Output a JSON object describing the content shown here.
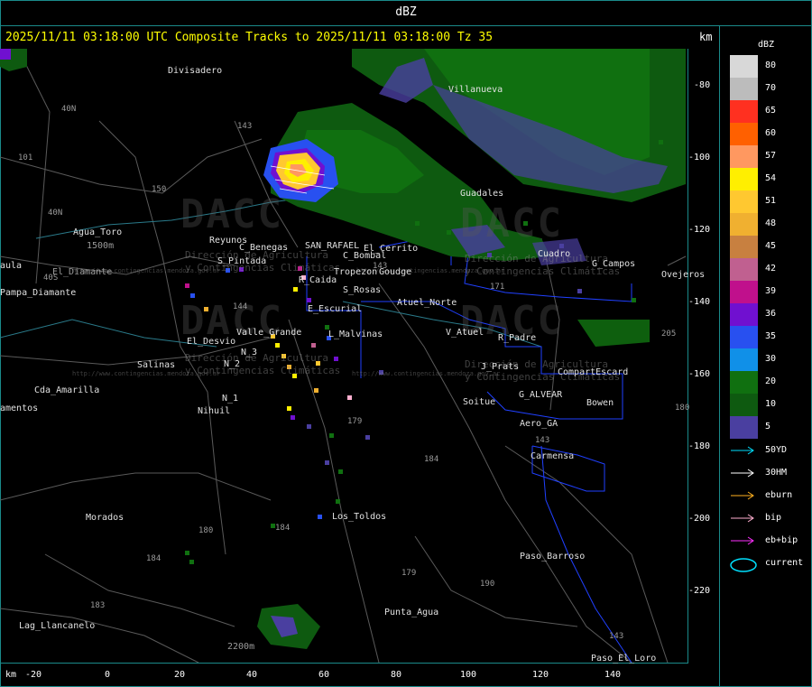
{
  "window": {
    "title": "dBZ"
  },
  "header": {
    "subtitle": "2025/11/11 03:18:00 UTC Composite Tracks to 2025/11/11 03:18:00 Tz 35",
    "km_label": "km"
  },
  "legend": {
    "title": "dBZ",
    "levels": [
      {
        "label": "80",
        "color": "#d8d8d8"
      },
      {
        "label": "70",
        "color": "#bcbcbc"
      },
      {
        "label": "65",
        "color": "#ff3020"
      },
      {
        "label": "60",
        "color": "#ff6000"
      },
      {
        "label": "57",
        "color": "#ff9860"
      },
      {
        "label": "54",
        "color": "#ffef00"
      },
      {
        "label": "51",
        "color": "#ffc830"
      },
      {
        "label": "48",
        "color": "#f0b030"
      },
      {
        "label": "45",
        "color": "#c88040"
      },
      {
        "label": "42",
        "color": "#c06090"
      },
      {
        "label": "39",
        "color": "#c0108c"
      },
      {
        "label": "36",
        "color": "#7010d0"
      },
      {
        "label": "35",
        "color": "#2850f0"
      },
      {
        "label": "30",
        "color": "#1090e8"
      },
      {
        "label": "20",
        "color": "#107010"
      },
      {
        "label": "10",
        "color": "#0e5a10"
      },
      {
        "label": "5",
        "color": "#4a3fa0"
      }
    ]
  },
  "tracks": [
    {
      "label": "50YD",
      "color": "#00e0ff"
    },
    {
      "label": "30HM",
      "color": "#ffffff"
    },
    {
      "label": "eburn",
      "color": "#ffb020"
    },
    {
      "label": "bip",
      "color": "#ffb0d0"
    },
    {
      "label": "eb+bip",
      "color": "#ff30ff"
    },
    {
      "label": "current",
      "color": "#00e0ff"
    }
  ],
  "axes": {
    "x_unit": "km",
    "x_ticks": [
      "-20",
      "0",
      "20",
      "40",
      "60",
      "80",
      "100",
      "120",
      "140"
    ],
    "y_ticks": [
      "-80",
      "-100",
      "-120",
      "-140",
      "-160",
      "-180",
      "-200",
      "-220"
    ]
  },
  "places": [
    {
      "name": "Divisadero"
    },
    {
      "name": "Villanueva"
    },
    {
      "name": "Agua_Toro"
    },
    {
      "name": "1500m"
    },
    {
      "name": "aula"
    },
    {
      "name": "El_Diamante"
    },
    {
      "name": "Reyunos"
    },
    {
      "name": "S_Pintada"
    },
    {
      "name": "Pampa_Diamante"
    },
    {
      "name": "C_Benegas"
    },
    {
      "name": "SAN_RAFAEL"
    },
    {
      "name": "El_Cerrito"
    },
    {
      "name": "C_Bombal"
    },
    {
      "name": "Tropezon"
    },
    {
      "name": "Goudge"
    },
    {
      "name": "R_Caida"
    },
    {
      "name": "S_Rosas"
    },
    {
      "name": "Atuel_Norte"
    },
    {
      "name": "E_Escurial"
    },
    {
      "name": "Valle_Grande"
    },
    {
      "name": "El_Desvio"
    },
    {
      "name": "L_Malvinas"
    },
    {
      "name": "V_Atuel"
    },
    {
      "name": "R_Padre"
    },
    {
      "name": "Salinas"
    },
    {
      "name": "N_2"
    },
    {
      "name": "N_3"
    },
    {
      "name": "Cda_Amarilla"
    },
    {
      "name": "N_1"
    },
    {
      "name": "Nihuil"
    },
    {
      "name": "amentos"
    },
    {
      "name": "J_Prats"
    },
    {
      "name": "G_ALVEAR"
    },
    {
      "name": "CompartEscard"
    },
    {
      "name": "Soitue"
    },
    {
      "name": "Bowen"
    },
    {
      "name": "Aero_GA"
    },
    {
      "name": "Carmensa"
    },
    {
      "name": "Morados"
    },
    {
      "name": "Los_Toldos"
    },
    {
      "name": "Paso_Barroso"
    },
    {
      "name": "Punta_Agua"
    },
    {
      "name": "Lag_Llancanelo"
    },
    {
      "name": "Paso_El_Loro"
    },
    {
      "name": "Guadales"
    },
    {
      "name": "G_Campos"
    },
    {
      "name": "Ovejeros"
    },
    {
      "name": "Cuadro"
    },
    {
      "name": "2200m"
    }
  ],
  "routes": [
    "143",
    "40N",
    "101",
    "150",
    "40N",
    "40S",
    "144",
    "171",
    "143",
    "205",
    "179",
    "184",
    "180",
    "184",
    "184",
    "183",
    "179",
    "190",
    "143",
    "143",
    "180"
  ],
  "watermark": {
    "brand": "DACC",
    "line1": "Dirección de Agricultura",
    "line2": "y Contingencias Climáticas",
    "url": "http://www.contingencias.mendoza.gov.ar"
  }
}
